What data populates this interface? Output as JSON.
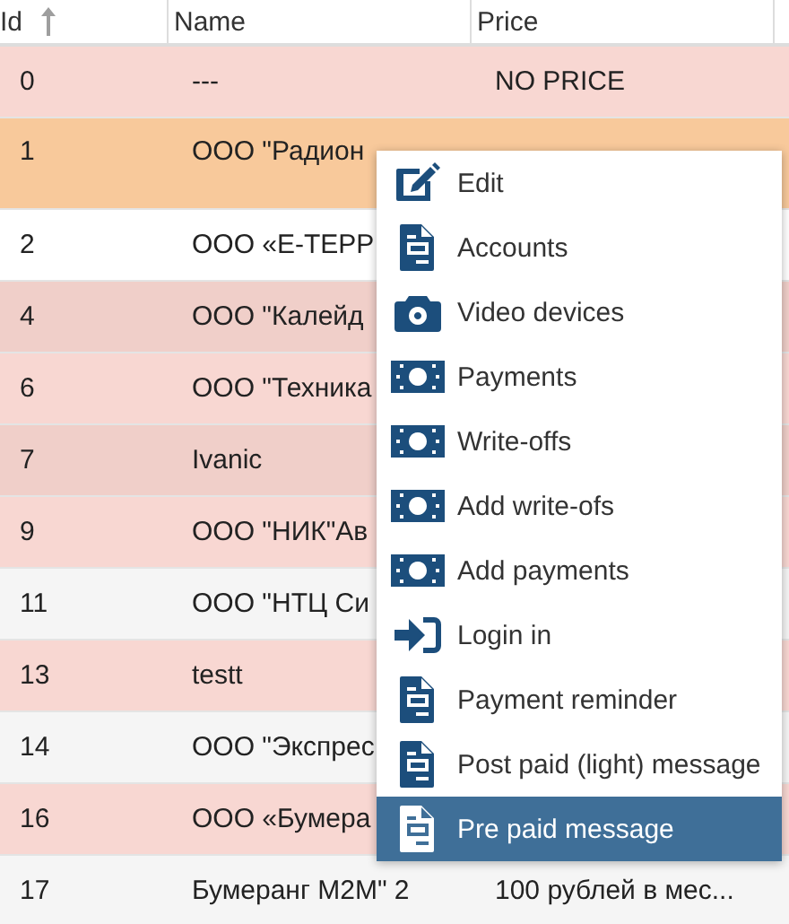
{
  "table": {
    "columns": [
      {
        "label": "Id",
        "sort_ascending": true
      },
      {
        "label": "Name"
      },
      {
        "label": "Price"
      }
    ],
    "rows": [
      {
        "id": "0",
        "name": "---",
        "price": "NO PRICE",
        "selected": false,
        "color": "#f8d7d2"
      },
      {
        "id": "1",
        "name": "ООО \"Радион",
        "selected": true
      },
      {
        "id": "2",
        "name": "ООО «Е-ТЕРР",
        "selected": false,
        "color": "#ffffff"
      },
      {
        "id": "4",
        "name": "ООО \"Калейд",
        "selected": false,
        "color": "#f0cfc9"
      },
      {
        "id": "6",
        "name": "ООО \"Техника",
        "selected": false,
        "color": "#f8d7d2"
      },
      {
        "id": "7",
        "name": "Ivanic",
        "selected": false,
        "color": "#f0cfc9"
      },
      {
        "id": "9",
        "name": "ООО \"НИК\"Ав",
        "selected": false,
        "color": "#f8d7d2"
      },
      {
        "id": "11",
        "name": "ООО \"НТЦ Си",
        "selected": false,
        "color": "#f5f5f5"
      },
      {
        "id": "13",
        "name": "testt",
        "selected": false,
        "color": "#f8d7d2"
      },
      {
        "id": "14",
        "name": "ООО \"Экспрес",
        "selected": false,
        "color": "#f5f5f5"
      },
      {
        "id": "16",
        "name": "ООО «Бумера",
        "selected": false,
        "color": "#f8d7d2"
      },
      {
        "id": "17",
        "name": "Бумеранг M2M\" 2",
        "price": "100 рублей в мес...",
        "selected": false,
        "color": "#f5f5f5"
      }
    ]
  },
  "context_menu": {
    "items": [
      {
        "label": "Edit",
        "kind": "edit",
        "selected": false
      },
      {
        "label": "Accounts",
        "kind": "document",
        "selected": false
      },
      {
        "label": "Video devices",
        "kind": "camera",
        "selected": false
      },
      {
        "label": "Payments",
        "kind": "money",
        "selected": false
      },
      {
        "label": "Write-offs",
        "kind": "money",
        "selected": false
      },
      {
        "label": "Add write-ofs",
        "kind": "money",
        "selected": false
      },
      {
        "label": "Add payments",
        "kind": "money",
        "selected": false
      },
      {
        "label": "Login in",
        "kind": "login",
        "selected": false
      },
      {
        "label": "Payment reminder",
        "kind": "document",
        "selected": false
      },
      {
        "label": "Post paid (light) message",
        "kind": "document",
        "selected": false
      },
      {
        "label": "Pre paid message",
        "kind": "document",
        "selected": true
      }
    ]
  }
}
